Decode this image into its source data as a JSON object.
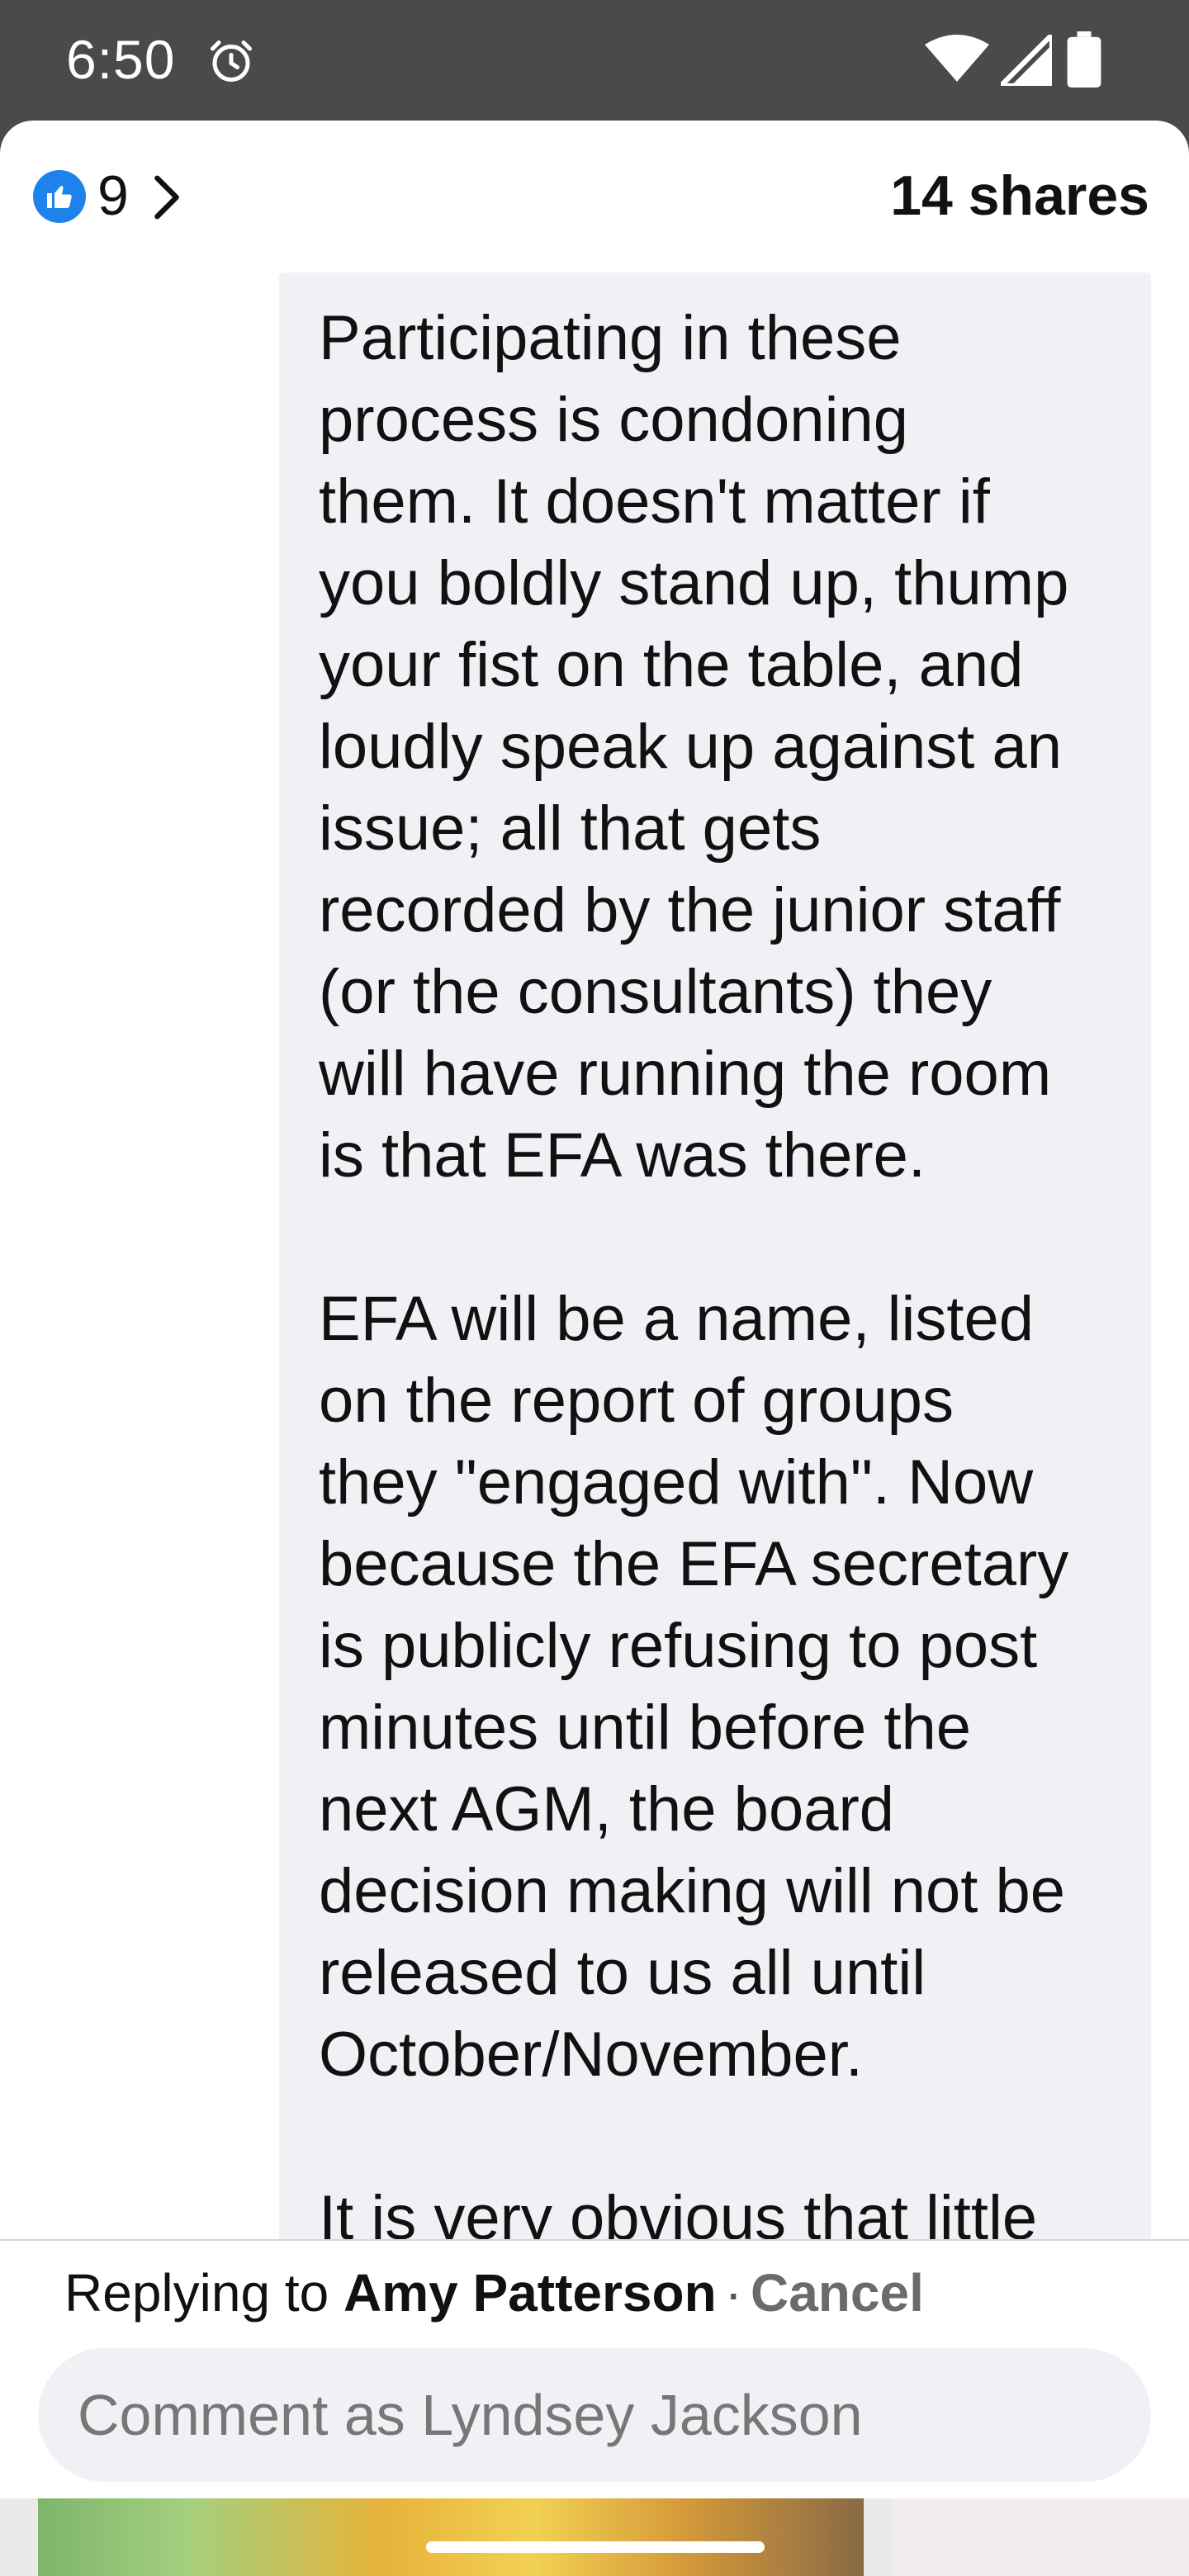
{
  "status_bar": {
    "time": "6:50",
    "icons": [
      "alarm-icon",
      "wifi-icon",
      "signal-icon",
      "battery-icon"
    ]
  },
  "header": {
    "reaction_icon": "thumbs-up-icon",
    "reaction_count": "9",
    "shares": "14 shares"
  },
  "comment": {
    "text": "Participating in these\nprocess is condoning\nthem. It doesn't matter if\nyou boldly stand up, thump\nyour fist on the table, and\nloudly speak up against an\nissue; all that gets\nrecorded by the junior staff\n(or the consultants) they\nwill have running the room\nis that EFA was there.\n\nEFA will be a name, listed\non the report of groups\nthey \"engaged with\". Now\nbecause the EFA secretary\nis publicly refusing to post\nminutes until before the\nnext AGM, the board\ndecision making will not be\nreleased to us all until\nOctober/November.\n\nIt is very obvious that little"
  },
  "reply": {
    "prefix": "Replying to",
    "name": "Amy Patterson",
    "separator": "·",
    "cancel": "Cancel",
    "placeholder": "Comment as Lyndsey Jackson"
  },
  "colors": {
    "accent": "#1d83ea",
    "status_bar_bg": "#4a4a4a",
    "bubble_bg": "#f0f1f5"
  }
}
